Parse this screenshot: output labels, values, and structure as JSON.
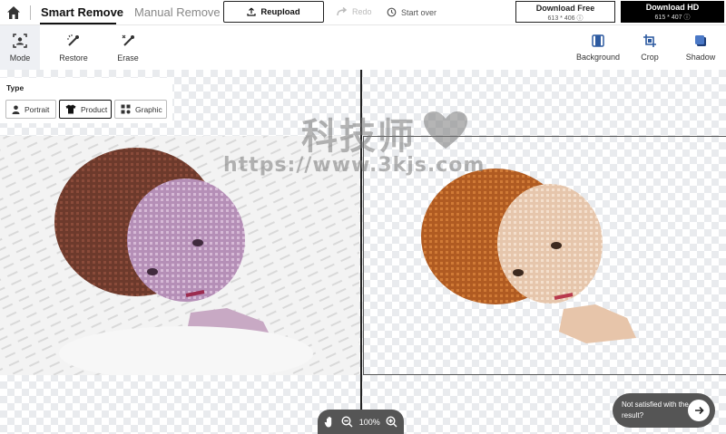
{
  "header": {
    "tabs": [
      "Smart Remove",
      "Manual Remove"
    ],
    "reupload_label": "Reupload",
    "redo_label": "Redo",
    "start_over_label": "Start over",
    "download_free": {
      "title": "Download Free",
      "size": "613 * 406 ⓘ"
    },
    "download_hd": {
      "title": "Download HD",
      "size": "615 * 407 ⓘ"
    }
  },
  "toolbar": {
    "left_tools": [
      "Mode",
      "Restore",
      "Erase"
    ],
    "right_tools": [
      "Background",
      "Crop",
      "Shadow"
    ]
  },
  "type_panel": {
    "label": "Type",
    "options": [
      "Portrait",
      "Product",
      "Graphic"
    ],
    "selected": "Product"
  },
  "zoom": {
    "level": "100%"
  },
  "feedback": {
    "text": "Not satisfied with the result?"
  },
  "watermark": {
    "title": "科技师",
    "url": "https://www.3kjs.com"
  },
  "colors": {
    "accent": "#111111",
    "canvas_check": "#e9ebee",
    "zoom_bar": "#555555"
  },
  "icons": [
    "home-icon",
    "upload-icon",
    "redo-icon",
    "history-icon",
    "mode-icon",
    "restore-icon",
    "erase-icon",
    "background-icon",
    "crop-icon",
    "shadow-icon",
    "person-icon",
    "shirt-icon",
    "graphic-icon",
    "hand-icon",
    "zoom-out-icon",
    "zoom-in-icon",
    "arrow-right-icon",
    "heart-icon"
  ]
}
